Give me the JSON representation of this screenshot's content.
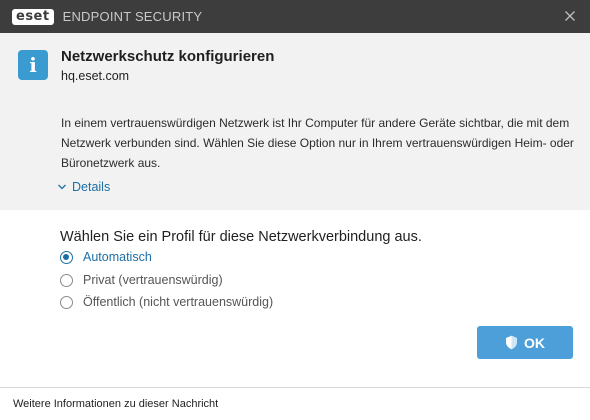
{
  "window": {
    "logo_text": "eset",
    "title": "ENDPOINT SECURITY",
    "close_icon": "close-icon"
  },
  "header": {
    "info_icon_glyph": "i",
    "heading": "Netzwerkschutz konfigurieren",
    "network_name": "hq.eset.com",
    "description": "In einem vertrauenswürdigen Netzwerk ist Ihr Computer für andere Geräte sichtbar, die mit dem Netzwerk verbunden sind. Wählen Sie diese Option nur in Ihrem vertrauenswürdigen Heim- oder Büronetzwerk aus.",
    "details_label": "Details"
  },
  "profile": {
    "prompt": "Wählen Sie ein Profil für diese Netzwerkverbindung aus.",
    "options": [
      {
        "label": "Automatisch",
        "selected": true
      },
      {
        "label": "Privat (vertrauenswürdig)",
        "selected": false
      },
      {
        "label": "Öffentlich (nicht vertrauenswürdig)",
        "selected": false
      }
    ]
  },
  "actions": {
    "ok_label": "OK"
  },
  "footer": {
    "more_info": "Weitere Informationen zu dieser Nachricht"
  },
  "colors": {
    "titlebar": "#3d3d3d",
    "accent": "#1c6fa5",
    "button": "#4c9fd8",
    "info_badge": "#3a9bd1",
    "header_bg": "#f2f2f2"
  }
}
